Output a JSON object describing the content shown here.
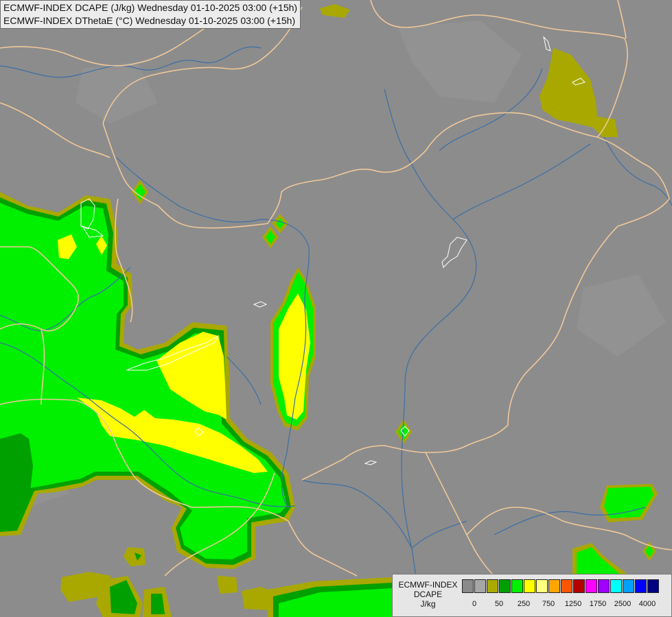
{
  "header": {
    "line1": "ECMWF-INDEX DCAPE (J/kg) Wednesday 01-10-2025 03:00 (+15h)",
    "line2": "ECMWF-INDEX DThetaE (°C) Wednesday 01-10-2025 03:00 (+15h)"
  },
  "legend": {
    "title_line1": "ECMWF-INDEX",
    "title_line2": "DCAPE",
    "unit": "J/kg",
    "colors": [
      "#8a8a8a",
      "#a6a6a6",
      "#aaaa00",
      "#00a000",
      "#00f000",
      "#ffff00",
      "#ffff80",
      "#ffa500",
      "#ff5500",
      "#b40000",
      "#ff00ff",
      "#a000ff",
      "#00ffff",
      "#00a0ff",
      "#0000ff",
      "#000080"
    ],
    "tick_labels": [
      "0",
      "50",
      "250",
      "750",
      "1250",
      "1750",
      "2500",
      "4000"
    ]
  },
  "map_colors": {
    "background": "#8c8c8c",
    "border": "#f0c89a",
    "river": "#3c6ea5",
    "lake": "#ffffff",
    "olive": "#a8a800",
    "dark_green": "#00a000",
    "green": "#00f000",
    "yellow": "#ffff00"
  }
}
